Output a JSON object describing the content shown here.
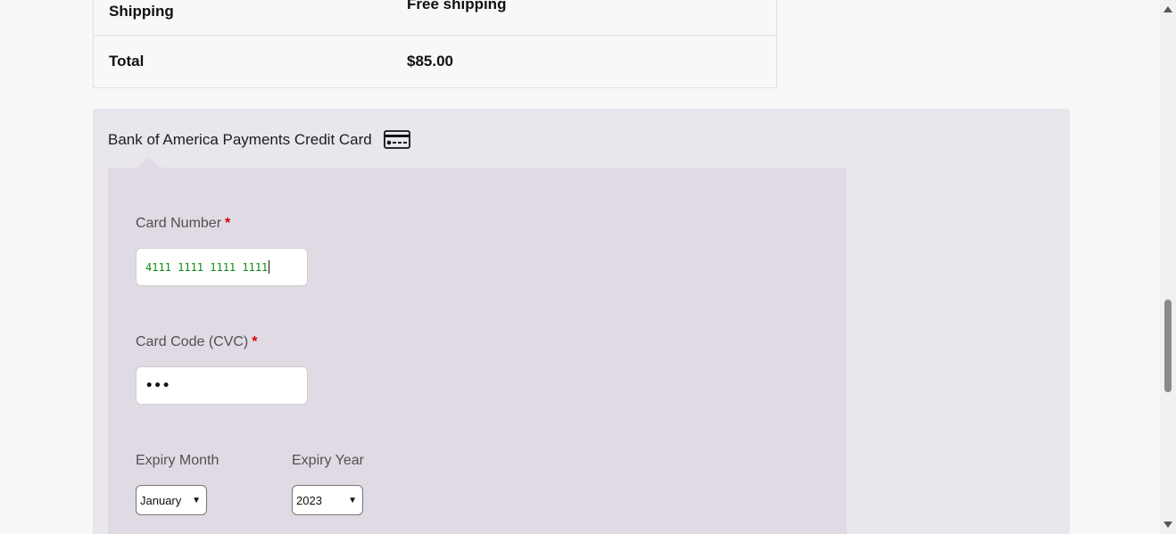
{
  "order_totals": {
    "shipping_label": "Shipping",
    "shipping_value": "Free shipping",
    "total_label": "Total",
    "total_value": "$85.00"
  },
  "payment_method": {
    "title": "Bank of America Payments Credit Card",
    "icon": "credit-card-icon",
    "fields": {
      "card_number": {
        "label": "Card Number",
        "required_mark": "*",
        "value": "4111 1111 1111 1111"
      },
      "card_code": {
        "label": "Card Code (CVC)",
        "required_mark": "*",
        "value": "•••"
      },
      "expiry_month": {
        "label": "Expiry Month",
        "selected": "January"
      },
      "expiry_year": {
        "label": "Expiry Year",
        "selected": "2023"
      }
    }
  },
  "colors": {
    "page_background": "#f8f8f8",
    "payment_background": "#e9e6ed",
    "payment_box_background": "#dfdae3",
    "required_mark": "#d40000",
    "card_number_text": "#0f8a15"
  }
}
